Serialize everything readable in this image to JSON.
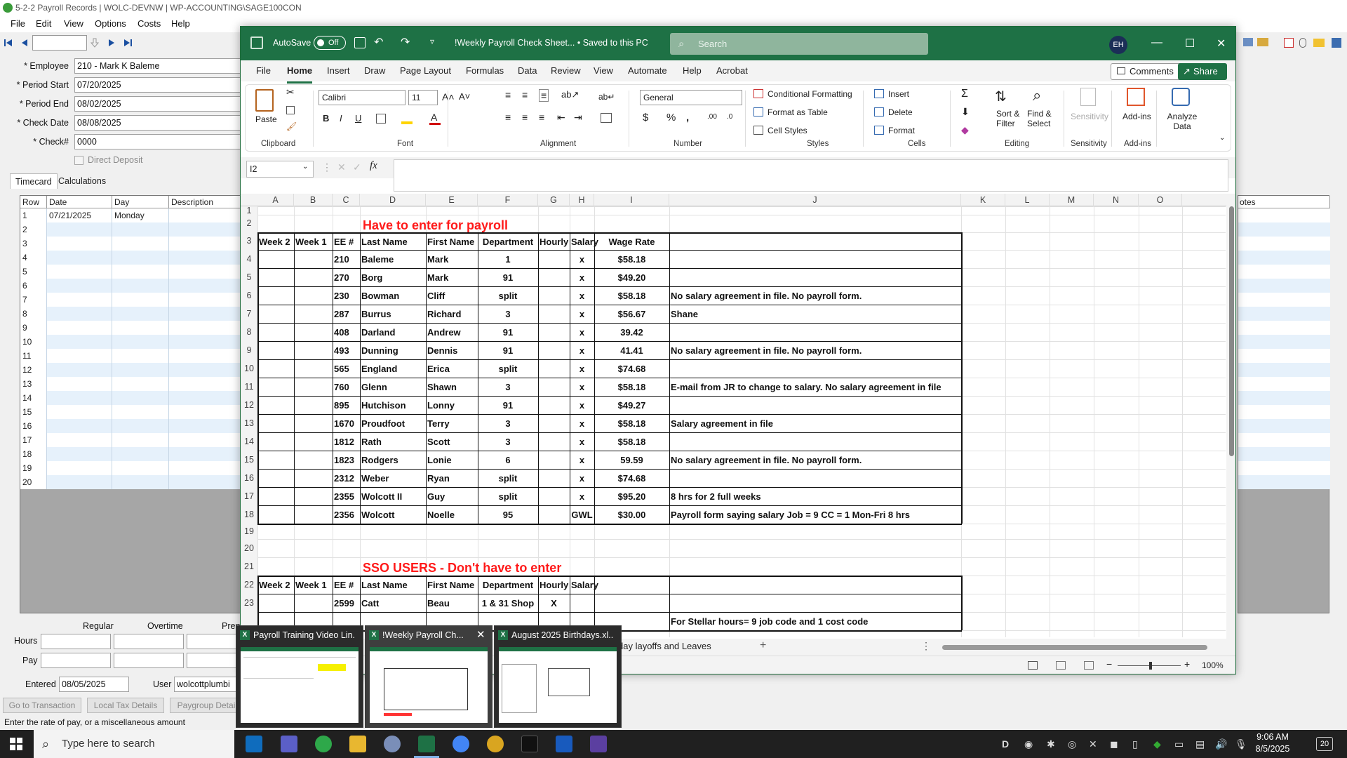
{
  "sage": {
    "title": "5-2-2 Payroll Records  |  WOLC-DEVNW  |  WP-ACCOUNTING\\SAGE100CON",
    "menu": [
      "File",
      "Edit",
      "View",
      "Options",
      "Costs",
      "Help"
    ],
    "fields": [
      {
        "label": "* Employee",
        "value": "210 - Mark K Baleme"
      },
      {
        "label": "* Period Start",
        "value": "07/20/2025"
      },
      {
        "label": "* Period End",
        "value": "08/02/2025"
      },
      {
        "label": "* Check Date",
        "value": "08/08/2025"
      },
      {
        "label": "* Check#",
        "value": "0000"
      }
    ],
    "direct_deposit": "Direct Deposit",
    "tabs": [
      "Timecard",
      "Calculations"
    ],
    "grid_headers": [
      "Row",
      "Date",
      "Day",
      "Description"
    ],
    "grid_first_row": {
      "row": "1",
      "date": "07/21/2025",
      "day": "Monday"
    },
    "grid_rows": [
      "1",
      "2",
      "3",
      "4",
      "5",
      "6",
      "7",
      "8",
      "9",
      "10",
      "11",
      "12",
      "13",
      "14",
      "15",
      "16",
      "17",
      "18",
      "19",
      "20"
    ],
    "right_header": "otes",
    "summary": {
      "regular": "Regular",
      "overtime": "Overtime",
      "prem": "Prem",
      "hours": "Hours",
      "pay": "Pay"
    },
    "entered_label": "Entered",
    "entered_value": "08/05/2025",
    "user_label": "User",
    "user_value": "wolcottplumbi",
    "buttons": [
      "Go to Transaction",
      "Local Tax Details",
      "Paygroup Detai"
    ],
    "status_message": "Enter the rate of pay, or a miscellaneous amount"
  },
  "excel": {
    "autosave": "AutoSave",
    "autosave_state": "Off",
    "doc_title": "!Weekly Payroll Check Sheet...  •  Saved to this PC",
    "search_placeholder": "Search",
    "user_initials": "EH",
    "ribbon_tabs": [
      "File",
      "Home",
      "Insert",
      "Draw",
      "Page Layout",
      "Formulas",
      "Data",
      "Review",
      "View",
      "Automate",
      "Help",
      "Acrobat"
    ],
    "active_tab": "Home",
    "comments": "Comments",
    "share": "Share",
    "ribbon": {
      "paste": "Paste",
      "font_name": "Calibri",
      "font_size": "11",
      "number_format": "General",
      "conditional_formatting": "Conditional Formatting",
      "format_as_table": "Format as Table",
      "cell_styles": "Cell Styles",
      "insert": "Insert",
      "delete": "Delete",
      "format": "Format",
      "sort_filter": "Sort & Filter",
      "find_select": "Find & Select",
      "sensitivity": "Sensitivity",
      "add_ins": "Add-ins",
      "analyze_data": "Analyze Data",
      "groups": [
        "Clipboard",
        "Font",
        "Alignment",
        "Number",
        "Styles",
        "Cells",
        "Editing",
        "Sensitivity",
        "Add-ins"
      ]
    },
    "name_box": "I2",
    "columns": [
      "A",
      "B",
      "C",
      "D",
      "E",
      "F",
      "G",
      "H",
      "I",
      "J",
      "K",
      "L",
      "M",
      "N",
      "O"
    ],
    "row_numbers": [
      "1",
      "2",
      "3",
      "4",
      "5",
      "6",
      "7",
      "8",
      "9",
      "10",
      "11",
      "12",
      "13",
      "14",
      "15",
      "16",
      "17",
      "18",
      "19",
      "20",
      "21",
      "22",
      "23"
    ],
    "section1_title": "Have to enter for payroll",
    "section2_title": "SSO USERS - Don't have to enter",
    "headers1": [
      "Week 2",
      "Week 1",
      "EE #",
      "Last Name",
      "First Name",
      "Department",
      "Hourly",
      "Salary",
      "Wage Rate"
    ],
    "headers2": [
      "Week 2",
      "Week 1",
      "EE #",
      "Last Name",
      "First Name",
      "Department",
      "Hourly",
      "Salary"
    ],
    "rows": [
      {
        "ee": "210",
        "last": "Baleme",
        "first": "Mark",
        "dept": "1",
        "hourly": "",
        "salary": "x",
        "rate": "$58.18",
        "note": ""
      },
      {
        "ee": "270",
        "last": "Borg",
        "first": "Mark",
        "dept": "91",
        "hourly": "",
        "salary": "x",
        "rate": "$49.20",
        "note": ""
      },
      {
        "ee": "230",
        "last": "Bowman",
        "first": "Cliff",
        "dept": "split",
        "hourly": "",
        "salary": "x",
        "rate": "$58.18",
        "note": "No salary agreement in file. No payroll form."
      },
      {
        "ee": "287",
        "last": "Burrus",
        "first": "Richard",
        "dept": "3",
        "hourly": "",
        "salary": "x",
        "rate": "$56.67",
        "note": "Shane"
      },
      {
        "ee": "408",
        "last": "Darland",
        "first": "Andrew",
        "dept": "91",
        "hourly": "",
        "salary": "x",
        "rate": "39.42",
        "note": ""
      },
      {
        "ee": "493",
        "last": "Dunning",
        "first": "Dennis",
        "dept": "91",
        "hourly": "",
        "salary": "x",
        "rate": "41.41",
        "note": "No salary agreement in file. No payroll form."
      },
      {
        "ee": "565",
        "last": "England",
        "first": "Erica",
        "dept": "split",
        "hourly": "",
        "salary": "x",
        "rate": "$74.68",
        "note": ""
      },
      {
        "ee": "760",
        "last": "Glenn",
        "first": "Shawn",
        "dept": "3",
        "hourly": "",
        "salary": "x",
        "rate": "$58.18",
        "note": "E-mail from JR to change to salary. No salary agreement in file"
      },
      {
        "ee": "895",
        "last": "Hutchison",
        "first": "Lonny",
        "dept": "91",
        "hourly": "",
        "salary": "x",
        "rate": "$49.27",
        "note": ""
      },
      {
        "ee": "1670",
        "last": "Proudfoot",
        "first": "Terry",
        "dept": "3",
        "hourly": "",
        "salary": "x",
        "rate": "$58.18",
        "note": "Salary agreement in file"
      },
      {
        "ee": "1812",
        "last": "Rath",
        "first": "Scott",
        "dept": "3",
        "hourly": "",
        "salary": "x",
        "rate": "$58.18",
        "note": ""
      },
      {
        "ee": "1823",
        "last": "Rodgers",
        "first": "Lonie",
        "dept": "6",
        "hourly": "",
        "salary": "x",
        "rate": "59.59",
        "note": "No salary agreement in file. No payroll form."
      },
      {
        "ee": "2312",
        "last": "Weber",
        "first": "Ryan",
        "dept": "split",
        "hourly": "",
        "salary": "x",
        "rate": "$74.68",
        "note": ""
      },
      {
        "ee": "2355",
        "last": "Wolcott II",
        "first": "Guy",
        "dept": "split",
        "hourly": "",
        "salary": "x",
        "rate": "$95.20",
        "note": "8 hrs for 2 full weeks"
      },
      {
        "ee": "2356",
        "last": "Wolcott",
        "first": "Noelle",
        "dept": "95",
        "hourly": "",
        "salary": "GWL",
        "rate": "$30.00",
        "note": "Payroll form saying salary       Job = 9 CC = 1 Mon-Fri      8 hrs"
      }
    ],
    "row23": {
      "ee": "2599",
      "last": "Catt",
      "first": "Beau",
      "dept": "1 & 31 Shop",
      "hourly": "X"
    },
    "row24_note": "For Stellar hours= 9 job code and 1 cost code",
    "sheet_tab_visible": "day layoffs and Leaves",
    "zoom": "100%"
  },
  "previews": [
    {
      "title": "Payroll Training Video Lin..."
    },
    {
      "title": "!Weekly Payroll Ch..."
    },
    {
      "title": "August 2025 Birthdays.xl..."
    }
  ],
  "taskbar": {
    "search_placeholder": "Type here to search",
    "time": "9:06 AM",
    "date": "8/5/2025",
    "notifications": "20"
  }
}
